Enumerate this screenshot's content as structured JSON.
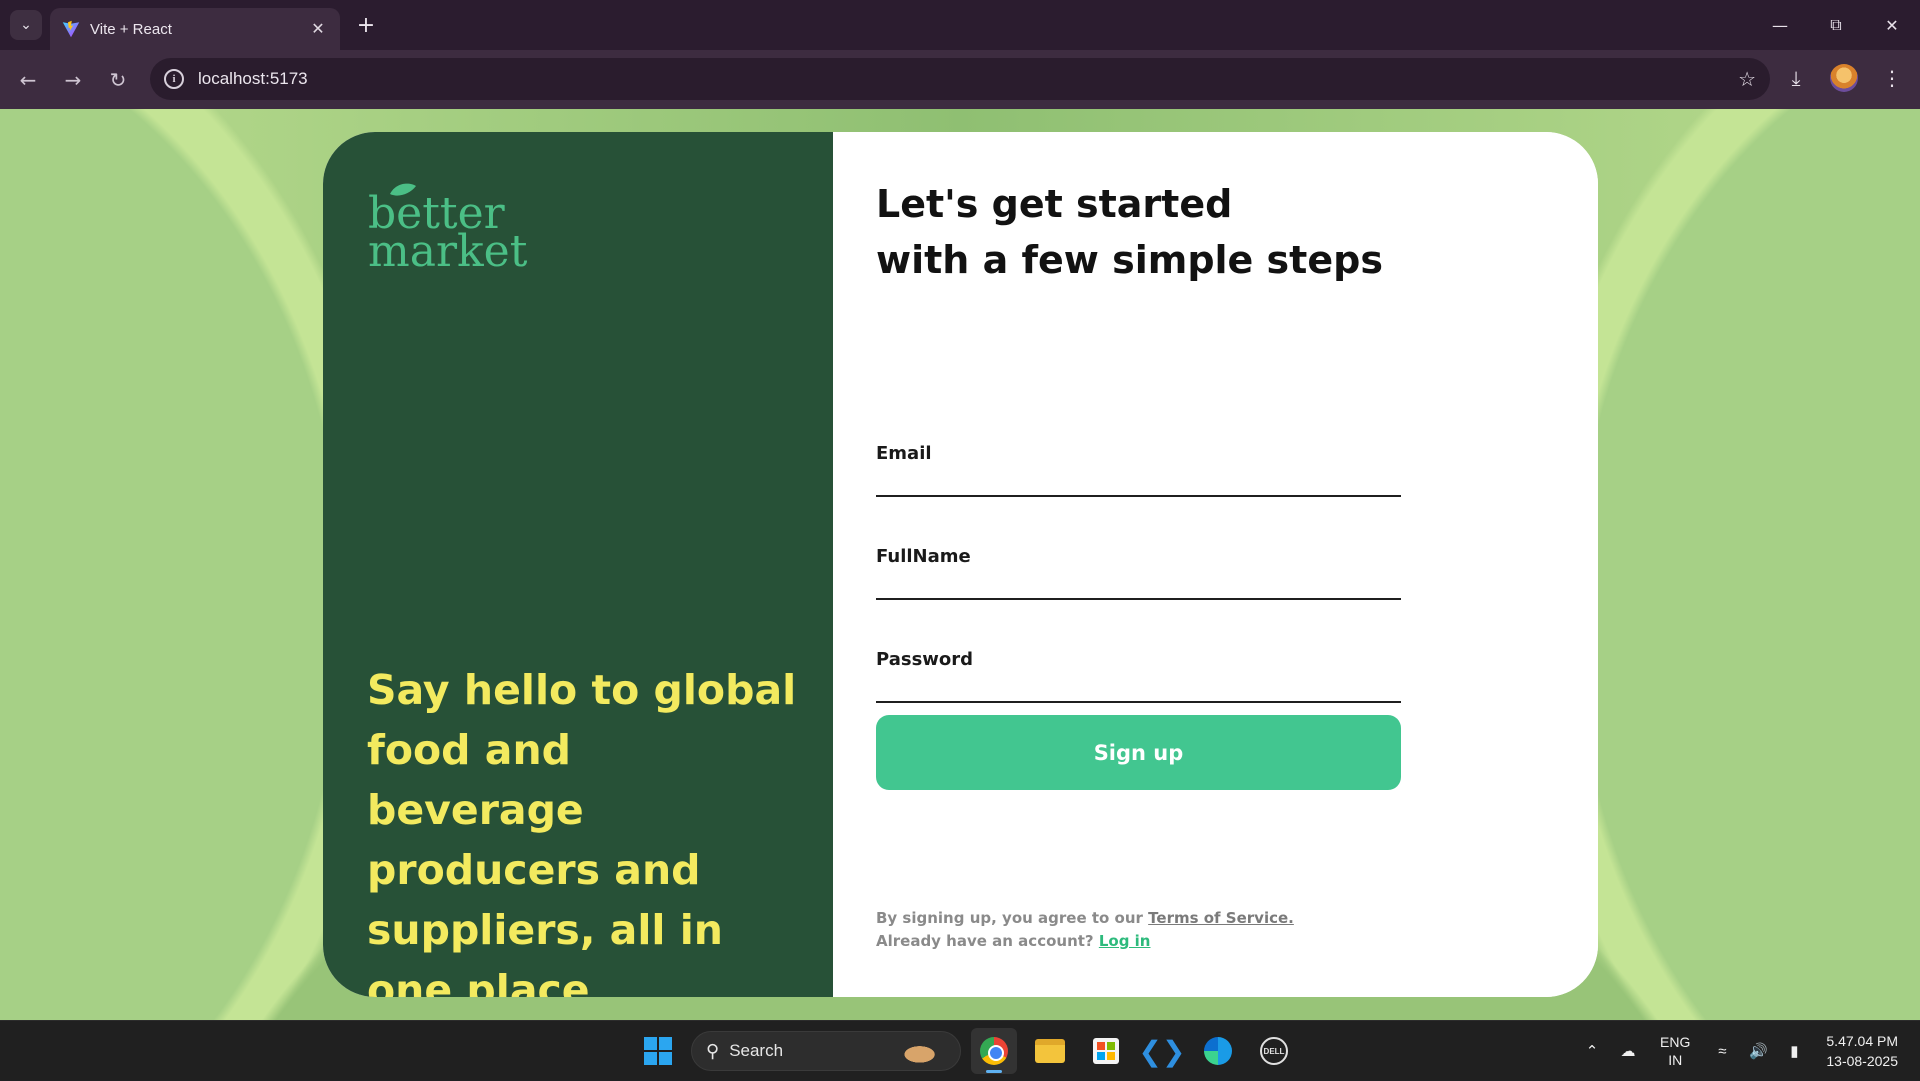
{
  "browser": {
    "tab_title": "Vite + React",
    "url": "localhost:5173",
    "icons": {
      "tab_search": "chevron-down-icon",
      "close_tab": "close-icon",
      "new_tab": "plus-icon",
      "back": "arrow-left-icon",
      "forward": "arrow-right-icon",
      "reload": "reload-icon",
      "site_info": "info-icon",
      "bookmark": "star-icon",
      "downloads": "download-icon",
      "menu": "kebab-menu-icon"
    }
  },
  "brand": {
    "logo_line1": "better",
    "logo_line2": "market",
    "logo_color": "#4bbf86"
  },
  "left_panel": {
    "tagline": "Say hello to global food and beverage producers and suppliers, all in one place",
    "background": "#275137",
    "tagline_color": "#f3ea5f"
  },
  "form": {
    "heading_line1": "Let's get started",
    "heading_line2": "with a few simple steps",
    "fields": [
      {
        "label": "Email",
        "value": ""
      },
      {
        "label": "FullName",
        "value": ""
      },
      {
        "label": "Password",
        "value": ""
      }
    ],
    "submit_label": "Sign up",
    "submit_color": "#42c690",
    "terms_prefix": "By signing up, you agree to our ",
    "terms_link": "Terms of Service.",
    "login_prefix": "Already have an account? ",
    "login_link": "Log in"
  },
  "taskbar": {
    "search_placeholder": "Search",
    "language_line1": "ENG",
    "language_line2": "IN",
    "time": "5.47.04 PM",
    "date": "13-08-2025",
    "apps": [
      "chrome",
      "file-explorer",
      "microsoft-store",
      "vscode",
      "edge",
      "dell"
    ]
  }
}
